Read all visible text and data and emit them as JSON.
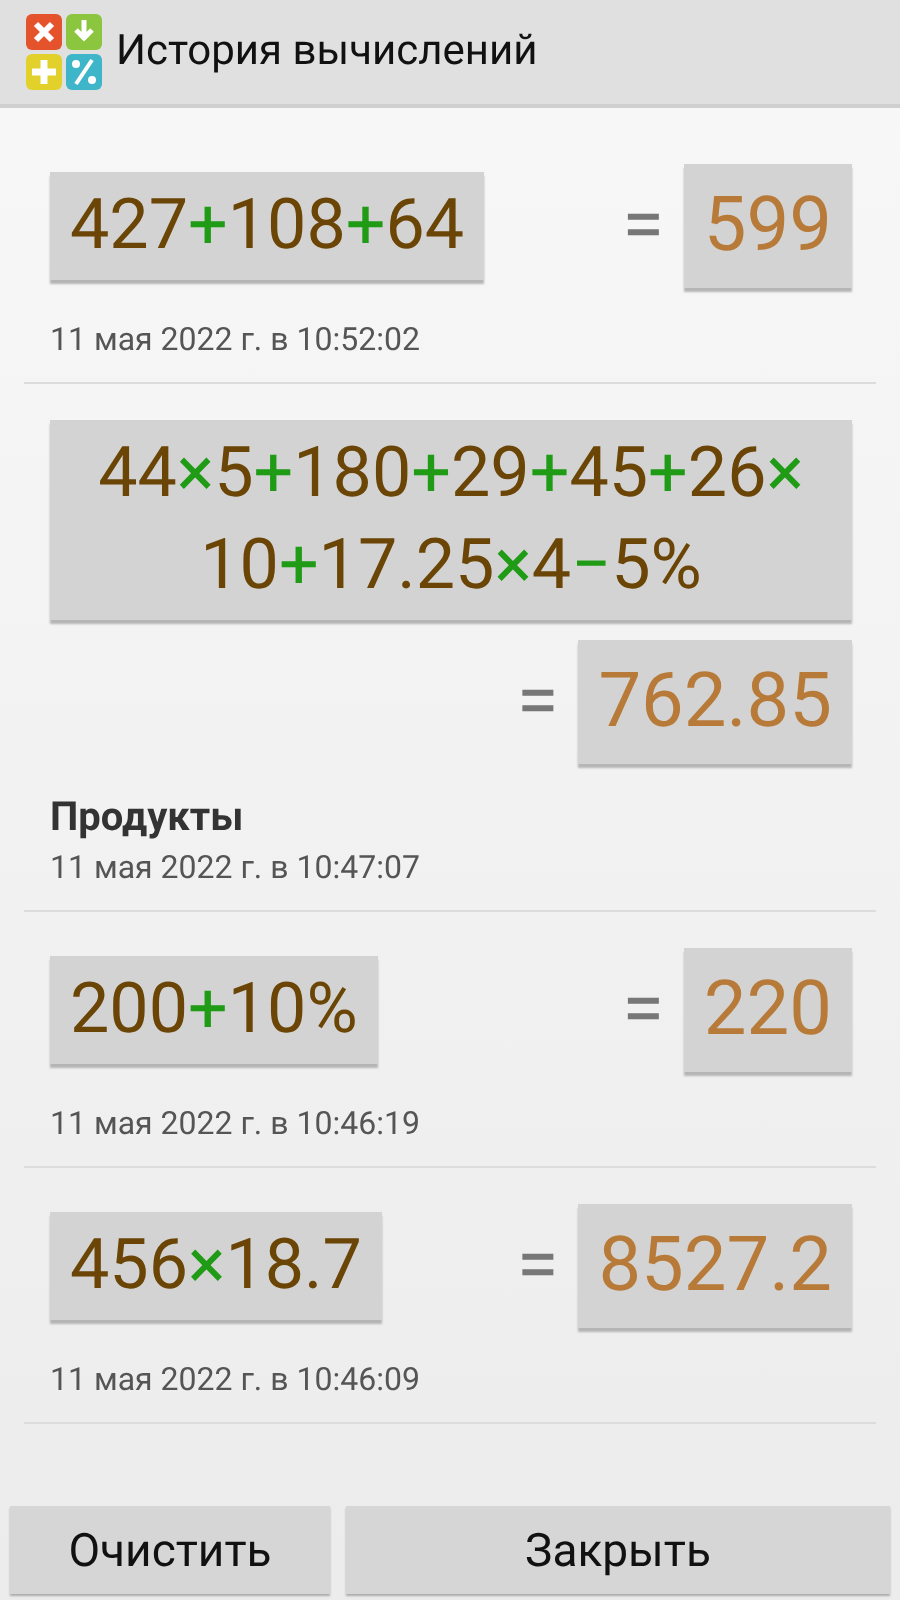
{
  "window": {
    "title": "История вычислений"
  },
  "entries": [
    {
      "expression": [
        {
          "kind": "number",
          "text": "427"
        },
        {
          "kind": "operator",
          "text": "+"
        },
        {
          "kind": "number",
          "text": "108"
        },
        {
          "kind": "operator",
          "text": "+"
        },
        {
          "kind": "number",
          "text": "64"
        }
      ],
      "equals": "=",
      "result": "599",
      "date": "11 мая 2022 г. в 10:52:02"
    },
    {
      "expression": [
        {
          "kind": "number",
          "text": "44"
        },
        {
          "kind": "operator",
          "text": "×"
        },
        {
          "kind": "number",
          "text": "5"
        },
        {
          "kind": "operator",
          "text": "+"
        },
        {
          "kind": "number",
          "text": "180"
        },
        {
          "kind": "operator",
          "text": "+"
        },
        {
          "kind": "number",
          "text": "29"
        },
        {
          "kind": "operator",
          "text": "+"
        },
        {
          "kind": "number",
          "text": "45"
        },
        {
          "kind": "operator",
          "text": "+"
        },
        {
          "kind": "number",
          "text": "26"
        },
        {
          "kind": "operator",
          "text": "×"
        },
        {
          "kind": "number",
          "text": "10"
        },
        {
          "kind": "operator",
          "text": "+"
        },
        {
          "kind": "number",
          "text": "17.25"
        },
        {
          "kind": "operator",
          "text": "×"
        },
        {
          "kind": "number",
          "text": "4"
        },
        {
          "kind": "operator",
          "text": "−"
        },
        {
          "kind": "number",
          "text": "5%"
        }
      ],
      "equals": "=",
      "result": "762.85",
      "note": "Продукты",
      "date": "11 мая 2022 г. в 10:47:07"
    },
    {
      "expression": [
        {
          "kind": "number",
          "text": "200"
        },
        {
          "kind": "operator",
          "text": "+"
        },
        {
          "kind": "number",
          "text": "10%"
        }
      ],
      "equals": "=",
      "result": "220",
      "date": "11 мая 2022 г. в 10:46:19"
    },
    {
      "expression": [
        {
          "kind": "number",
          "text": "456"
        },
        {
          "kind": "operator",
          "text": "×"
        },
        {
          "kind": "number",
          "text": "18.7"
        }
      ],
      "equals": "=",
      "result": "8527.2",
      "date": "11 мая 2022 г. в 10:46:09"
    }
  ],
  "buttons": [
    "Очистить",
    "Закрыть"
  ]
}
